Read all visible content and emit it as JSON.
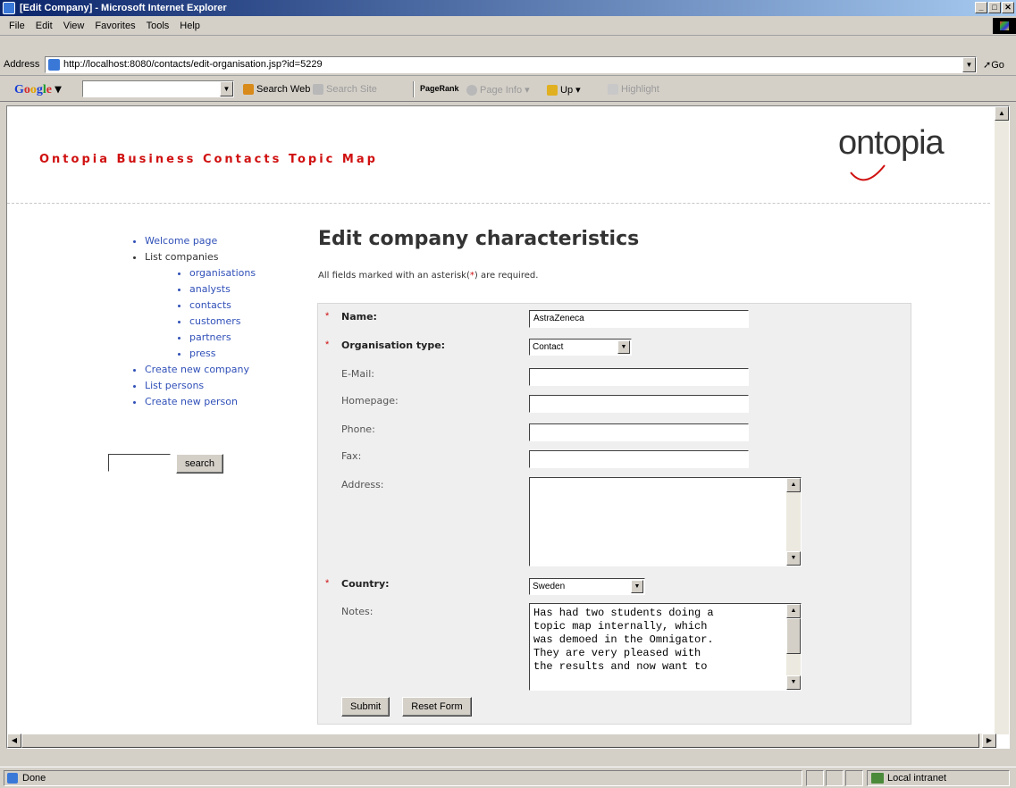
{
  "window": {
    "title": "[Edit Company] - Microsoft Internet Explorer",
    "controls": [
      "_",
      "□",
      "✕"
    ]
  },
  "menu": [
    "File",
    "Edit",
    "View",
    "Favorites",
    "Tools",
    "Help"
  ],
  "address": {
    "label": "Address",
    "url": "http://localhost:8080/contacts/edit-organisation.jsp?id=5229",
    "go": "Go"
  },
  "google_toolbar": {
    "logo": "Google",
    "search_web": "Search Web",
    "search_site": "Search Site",
    "pagerank": "PageRank",
    "page_info": "Page Info",
    "up": "Up",
    "highlight": "Highlight"
  },
  "site": {
    "title": "Ontopia Business Contacts Topic Map",
    "logo_text": "ontopia"
  },
  "nav": {
    "welcome": "Welcome page",
    "list_companies": "List companies",
    "sub": [
      "organisations",
      "analysts",
      "contacts",
      "customers",
      "partners",
      "press"
    ],
    "create_company": "Create new company",
    "list_persons": "List persons",
    "create_person": "Create new person"
  },
  "search": {
    "button": "search",
    "value": ""
  },
  "page": {
    "heading": "Edit company characteristics",
    "required_note_pre": "All fields marked with an asterisk(",
    "required_note_star": "*",
    "required_note_post": ") are required."
  },
  "form": {
    "name": {
      "label": "Name:",
      "value": "AstraZeneca",
      "required": true
    },
    "org_type": {
      "label": "Organisation type:",
      "value": "Contact",
      "required": true
    },
    "email": {
      "label": "E-Mail:",
      "value": ""
    },
    "homepage": {
      "label": "Homepage:",
      "value": ""
    },
    "phone": {
      "label": "Phone:",
      "value": ""
    },
    "fax": {
      "label": "Fax:",
      "value": ""
    },
    "address": {
      "label": "Address:",
      "value": ""
    },
    "country": {
      "label": "Country:",
      "value": "Sweden",
      "required": true
    },
    "notes": {
      "label": "Notes:",
      "value": "Has had two students doing a\ntopic map internally, which\nwas demoed in the Omnigator.\nThey are very pleased with\nthe results and now want to"
    },
    "submit": "Submit",
    "reset": "Reset Form",
    "star": "*"
  },
  "status": {
    "text": "Done",
    "zone": "Local intranet"
  }
}
